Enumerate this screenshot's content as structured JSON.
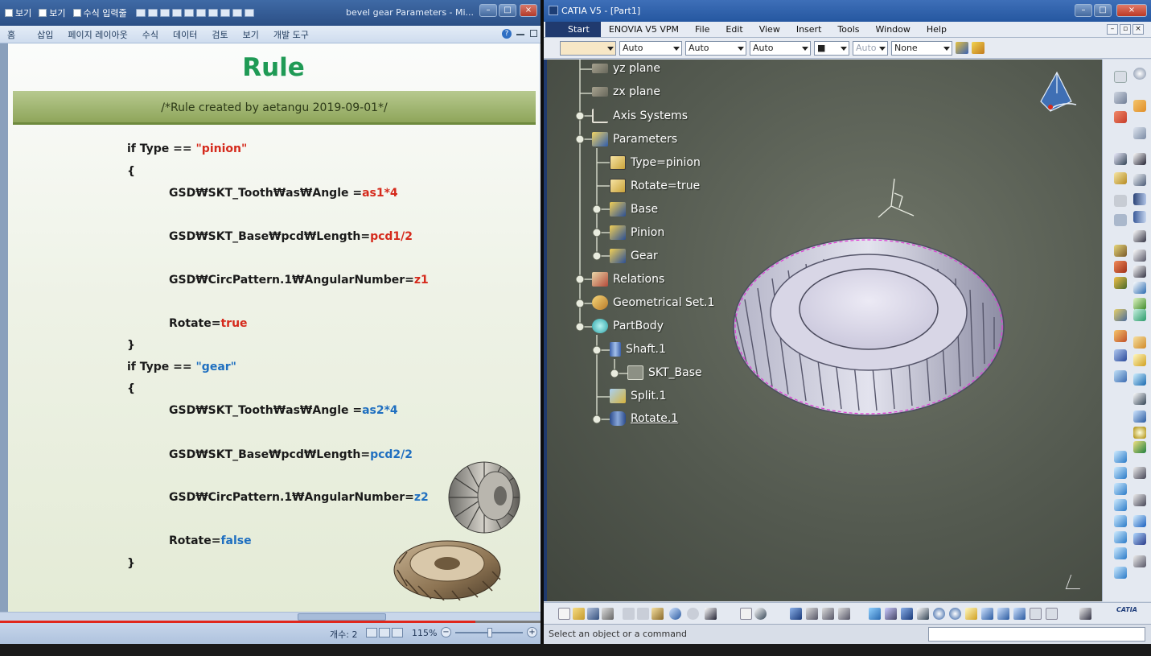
{
  "excel": {
    "quick_access": [
      "보기",
      "보기",
      "수식 입력줄"
    ],
    "window_title": "bevel gear Parameters - Mi...",
    "ribbon_tabs": [
      "홈",
      "삽입",
      "페이지 레이아웃",
      "수식",
      "데이터",
      "검토",
      "보기",
      "개발 도구"
    ],
    "slide": {
      "title": "Rule",
      "comment": "/*Rule created by aetangu 2019-09-01*/",
      "lines": [
        {
          "pre": "if Type  ==  ",
          "val": "\"pinion\"",
          "color": "red"
        },
        {
          "pre": "{",
          "val": "",
          "color": ""
        },
        {
          "pre": "GSD₩SKT_Tooth₩as₩Angle =",
          "val": "as1*4",
          "color": "red"
        },
        {
          "pre": "GSD₩SKT_Base₩pcd₩Length=",
          "val": "pcd1/2",
          "color": "red"
        },
        {
          "pre": "GSD₩CircPattern.1₩AngularNumber=",
          "val": "z1",
          "color": "red"
        },
        {
          "pre": "Rotate=",
          "val": "true",
          "color": "red"
        },
        {
          "pre": "}",
          "val": "",
          "color": ""
        },
        {
          "pre": "if Type  ==  ",
          "val": "\"gear\"",
          "color": "blue"
        },
        {
          "pre": "{",
          "val": "",
          "color": ""
        },
        {
          "pre": "GSD₩SKT_Tooth₩as₩Angle =",
          "val": "as2*4",
          "color": "blue"
        },
        {
          "pre": "GSD₩SKT_Base₩pcd₩Length=",
          "val": "pcd2/2",
          "color": "blue"
        },
        {
          "pre": "GSD₩CircPattern.1₩AngularNumber=",
          "val": "z2",
          "color": "blue"
        },
        {
          "pre": "Rotate=",
          "val": "false",
          "color": "blue"
        },
        {
          "pre": "}",
          "val": "",
          "color": ""
        }
      ]
    },
    "status": {
      "count": "개수: 2",
      "zoom": "115%",
      "zoom_minus": "−",
      "zoom_plus": "+"
    },
    "video_progress": 0.88
  },
  "catia": {
    "window_title": "CATIA V5 - [Part1]",
    "menu": [
      "Start",
      "ENOVIA V5 VPM",
      "File",
      "Edit",
      "View",
      "Insert",
      "Tools",
      "Window",
      "Help"
    ],
    "toolbar_dropdowns": [
      "",
      "Auto",
      "Auto",
      "Auto",
      "■",
      "Auto",
      "None"
    ],
    "tree": [
      {
        "label": "yz plane",
        "icon": "plane-icon"
      },
      {
        "label": "zx plane",
        "icon": "plane-icon"
      },
      {
        "label": "Axis Systems",
        "icon": "axis-systems-icon"
      },
      {
        "label": "Parameters",
        "icon": "parameters-icon"
      },
      {
        "label": "Type=pinion",
        "icon": "parameter-icon"
      },
      {
        "label": "Rotate=true",
        "icon": "parameter-icon"
      },
      {
        "label": "Base",
        "icon": "parameter-set-icon"
      },
      {
        "label": "Pinion",
        "icon": "parameter-set-icon"
      },
      {
        "label": "Gear",
        "icon": "parameter-set-icon"
      },
      {
        "label": "Relations",
        "icon": "relations-icon"
      },
      {
        "label": "Geometrical Set.1",
        "icon": "geometrical-set-icon"
      },
      {
        "label": "PartBody",
        "icon": "partbody-icon"
      },
      {
        "label": "Shaft.1",
        "icon": "shaft-icon"
      },
      {
        "label": "SKT_Base",
        "icon": "sketch-icon"
      },
      {
        "label": "Split.1",
        "icon": "split-icon"
      },
      {
        "label": "Rotate.1",
        "icon": "rotate-icon"
      }
    ],
    "status_message": "Select an object or a command",
    "brand": "CATIA"
  },
  "colors": {
    "rule_title": "#1f9a55",
    "value_red": "#d52a1c",
    "value_blue": "#1f6fc0",
    "progress": "#e0271c"
  }
}
